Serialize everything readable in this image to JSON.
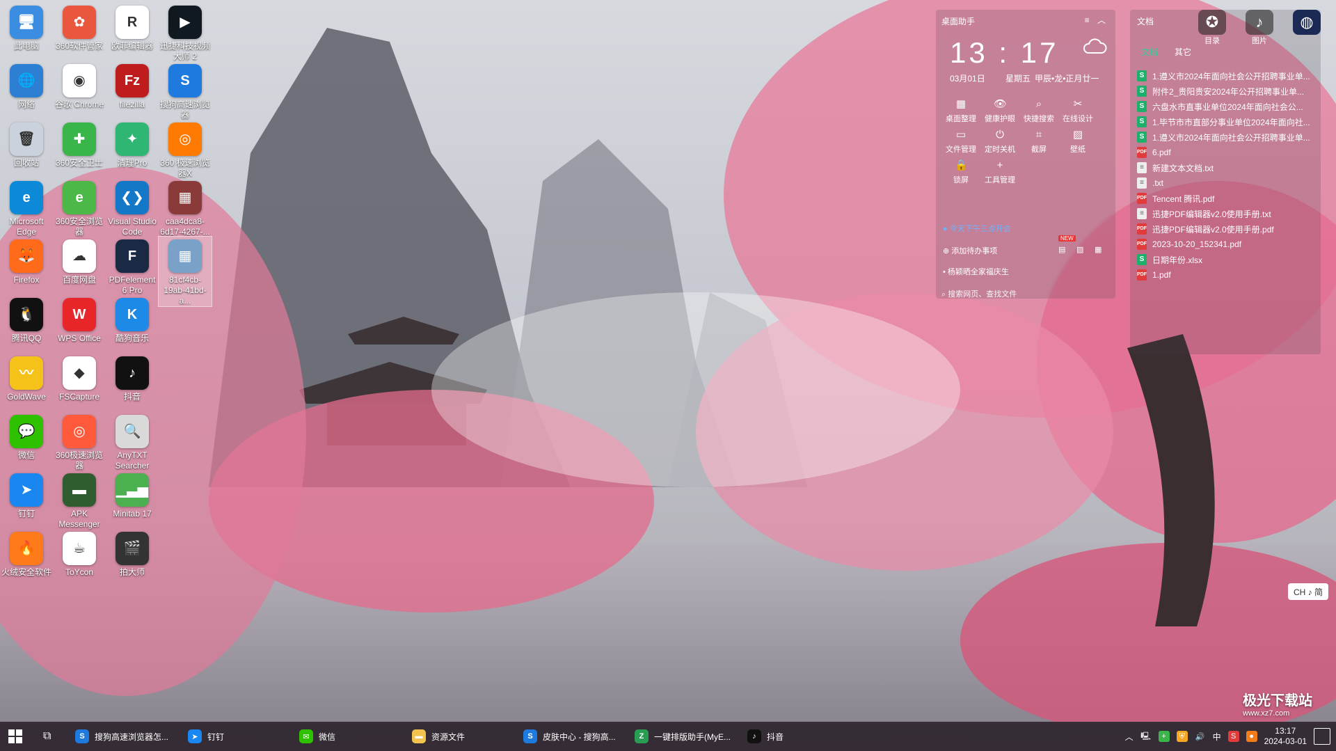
{
  "desktop": {
    "icons": [
      {
        "label": "此电脑",
        "color": "#3a8de0",
        "glyph": "🖥"
      },
      {
        "label": "360软件管家",
        "color": "#e9573f",
        "glyph": "✿"
      },
      {
        "label": "欧菲编辑器",
        "color": "#ffffff",
        "glyph": "R"
      },
      {
        "label": "迅捷科技视频大师 2",
        "color": "#101820",
        "glyph": "▶"
      },
      {
        "label": "网络",
        "color": "#2d7fd3",
        "glyph": "🌐"
      },
      {
        "label": "谷歌 Chrome",
        "color": "#ffffff",
        "glyph": "◉"
      },
      {
        "label": "filezilla",
        "color": "#bf1d1d",
        "glyph": "Fz"
      },
      {
        "label": "搜狗高速浏览器",
        "color": "#1f7ae0",
        "glyph": "S"
      },
      {
        "label": "回收站",
        "color": "#c9d2dd",
        "glyph": "🗑"
      },
      {
        "label": "360安全卫士",
        "color": "#3ab54a",
        "glyph": "✚"
      },
      {
        "label": "清理Pro",
        "color": "#2fb673",
        "glyph": "✦"
      },
      {
        "label": "360 极速浏览器X",
        "color": "#ff7a00",
        "glyph": "◎"
      },
      {
        "label": "Microsoft Edge",
        "color": "#0c8ad8",
        "glyph": "e"
      },
      {
        "label": "360安全浏览器",
        "color": "#4cb848",
        "glyph": "e"
      },
      {
        "label": "Visual Studio Code",
        "color": "#1478c8",
        "glyph": "❮❯"
      },
      {
        "label": "caa4dca8-6d17-4267-...",
        "color": "#8b3a3a",
        "glyph": "▦"
      },
      {
        "label": "Firefox",
        "color": "#ff6b1a",
        "glyph": "🦊"
      },
      {
        "label": "百度网盘",
        "color": "#ffffff",
        "glyph": "☁"
      },
      {
        "label": "PDFelement 6 Pro",
        "color": "#1a2a44",
        "glyph": "F"
      },
      {
        "label": "81cf4cb-19ab-41bd-a...",
        "color": "#7aa1c8",
        "glyph": "▦"
      },
      {
        "label": "腾讯QQ",
        "color": "#111111",
        "glyph": "🐧"
      },
      {
        "label": "WPS Office",
        "color": "#e8262a",
        "glyph": "W"
      },
      {
        "label": "酷狗音乐",
        "color": "#1e8ae8",
        "glyph": "K"
      },
      {
        "label": "GoldWave",
        "color": "#f5c21a",
        "glyph": "〰"
      },
      {
        "label": "FSCapture",
        "color": "#ffffff",
        "glyph": "◆"
      },
      {
        "label": "抖音",
        "color": "#111111",
        "glyph": "♪"
      },
      {
        "label": "微信",
        "color": "#2dc100",
        "glyph": "💬"
      },
      {
        "label": "360极速浏览器",
        "color": "#ff5a3c",
        "glyph": "◎"
      },
      {
        "label": "AnyTXT Searcher",
        "color": "#d9d9d9",
        "glyph": "🔍"
      },
      {
        "label": "钉钉",
        "color": "#1a86f0",
        "glyph": "➤"
      },
      {
        "label": "APK Messenger",
        "color": "#2f5d2f",
        "glyph": "▬"
      },
      {
        "label": "Minitab 17",
        "color": "#4caf50",
        "glyph": "▁▃▅"
      },
      {
        "label": "火绒安全软件",
        "color": "#ff7a1a",
        "glyph": "🔥"
      },
      {
        "label": "ToYcon",
        "color": "#ffffff",
        "glyph": "☕"
      },
      {
        "label": "拍大师",
        "color": "#333333",
        "glyph": "🎬"
      }
    ]
  },
  "widget": {
    "title": "桌面助手",
    "time": "13 : 17",
    "date": "03月01日",
    "weekday": "星期五",
    "lunar": "甲辰•龙•正月廿一",
    "tools": [
      {
        "label": "桌面整理",
        "icon": "▦"
      },
      {
        "label": "健康护眼",
        "icon": "👁"
      },
      {
        "label": "快捷搜索",
        "icon": "⌕"
      },
      {
        "label": "在线设计",
        "icon": "✂"
      },
      {
        "label": "文件管理",
        "icon": "▭"
      },
      {
        "label": "定时关机",
        "icon": "⏻"
      },
      {
        "label": "截屏",
        "icon": "⌗"
      },
      {
        "label": "壁纸",
        "icon": "▨"
      },
      {
        "label": "锁屏",
        "icon": "🔒"
      },
      {
        "label": "工具管理",
        "icon": "+"
      }
    ],
    "reminder": "今天下午三点开会",
    "new_badge": "NEW",
    "add_todo": "添加待办事项",
    "note": "杨颖晒全家福庆生",
    "search_placeholder": "搜索网页、查找文件"
  },
  "files": {
    "title": "文档",
    "tabs": [
      {
        "label": "文档",
        "active": true
      },
      {
        "label": "其它",
        "active": false
      }
    ],
    "items": [
      {
        "name": "1.遵义市2024年面向社会公开招聘事业单...",
        "type": "s"
      },
      {
        "name": "附件2_贵阳贵安2024年公开招聘事业单...",
        "type": "s"
      },
      {
        "name": "六盘水市直事业单位2024年面向社会公...",
        "type": "s"
      },
      {
        "name": "1.毕节市市直部分事业单位2024年面向社...",
        "type": "s"
      },
      {
        "name": "1.遵义市2024年面向社会公开招聘事业单...",
        "type": "s"
      },
      {
        "name": "6.pdf",
        "type": "pdf"
      },
      {
        "name": "新建文本文档.txt",
        "type": "txt"
      },
      {
        "name": ".txt",
        "type": "txt"
      },
      {
        "name": "Tencent 腾讯.pdf",
        "type": "pdf"
      },
      {
        "name": "迅捷PDF编辑器v2.0使用手册.txt",
        "type": "txt"
      },
      {
        "name": "迅捷PDF编辑器v2.0使用手册.pdf",
        "type": "pdf"
      },
      {
        "name": "2023-10-20_152341.pdf",
        "type": "pdf"
      },
      {
        "name": "日期年份.xlsx",
        "type": "s"
      },
      {
        "name": "1.pdf",
        "type": "pdf"
      }
    ],
    "shortcuts": [
      {
        "label": "目录",
        "icon": "✪"
      },
      {
        "label": "图片",
        "icon": "♪"
      }
    ]
  },
  "ime": {
    "label": "CH ♪ 简"
  },
  "taskbar": {
    "apps": [
      {
        "label": "搜狗高速浏览器怎...",
        "color": "#1f7ae0",
        "glyph": "S"
      },
      {
        "label": "钉钉",
        "color": "#1a86f0",
        "glyph": "➤"
      },
      {
        "label": "微信",
        "color": "#2dc100",
        "glyph": "✉"
      },
      {
        "label": "资源文件",
        "color": "#f2c44f",
        "glyph": "▬"
      },
      {
        "label": "皮肤中心 - 搜狗高...",
        "color": "#1f7ae0",
        "glyph": "S"
      },
      {
        "label": "一键排版助手(MyE...",
        "color": "#2a9d55",
        "glyph": "Z"
      },
      {
        "label": "抖音",
        "color": "#111111",
        "glyph": "♪"
      }
    ],
    "tray": {
      "lang": "中",
      "time": "13:17",
      "date": "2024-03-01"
    }
  },
  "watermark": {
    "title": "极光下载站",
    "subtitle": "www.xz7.com"
  }
}
